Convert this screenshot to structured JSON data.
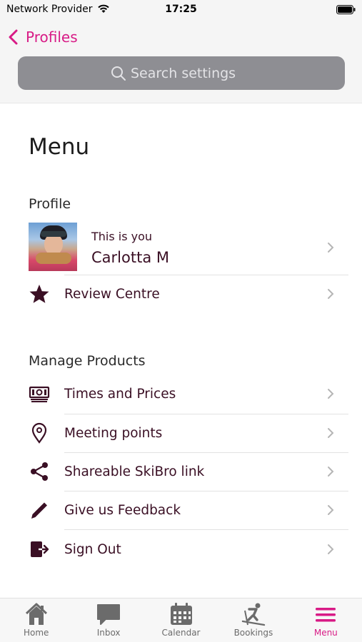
{
  "status_bar": {
    "carrier": "Network Provider",
    "time": "17:25"
  },
  "header": {
    "back_label": "Profiles",
    "search_placeholder": "Search settings"
  },
  "page": {
    "title": "Menu"
  },
  "profile_section": {
    "title": "Profile",
    "subtitle": "This is you",
    "name": "Carlotta M",
    "review_label": "Review Centre"
  },
  "products_section": {
    "title": "Manage Products",
    "items": [
      {
        "label": "Times and Prices",
        "icon": "money-icon"
      },
      {
        "label": "Meeting points",
        "icon": "location-pin-icon"
      },
      {
        "label": "Shareable SkiBro link",
        "icon": "share-icon"
      },
      {
        "label": "Give us Feedback",
        "icon": "pencil-icon"
      },
      {
        "label": "Sign Out",
        "icon": "sign-out-icon"
      }
    ]
  },
  "tab_bar": {
    "tabs": [
      {
        "label": "Home",
        "icon": "home-icon"
      },
      {
        "label": "Inbox",
        "icon": "chat-icon"
      },
      {
        "label": "Calendar",
        "icon": "calendar-icon"
      },
      {
        "label": "Bookings",
        "icon": "skier-icon"
      },
      {
        "label": "Menu",
        "icon": "menu-icon",
        "active": true
      }
    ]
  },
  "colors": {
    "accent": "#d81b86",
    "text": "#3a0f24",
    "search_bg": "#8e8e93"
  }
}
